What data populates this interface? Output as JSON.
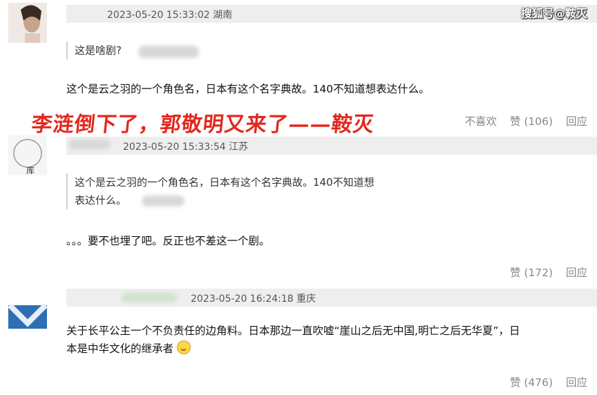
{
  "watermark": "搜狐号@鞍灭",
  "banner": "李涟倒下了，郭敬明又来了——鞍灭",
  "comments": [
    {
      "timestamp": "2023-05-20 15:33:02",
      "location": "湖南",
      "quote": "这是啥剧?",
      "reply": "这个是云之羽的一个角色名，日本有这个名字典故。140不知道想表达什么。",
      "dislike_label": "不喜欢",
      "like_label": "赞 (106)",
      "reply_label": "回应"
    },
    {
      "timestamp": "2023-05-20 15:33:54",
      "location": "江苏",
      "quote_line1": "这个是云之羽的一个角色名，日本有这个名字典故。140不知道想",
      "quote_line2": "表达什么。",
      "reply": "。。。要不也埋了吧。反正也不差这一个剧。",
      "like_label": "赞 (172)",
      "reply_label": "回应"
    },
    {
      "timestamp": "2023-05-20 16:24:18",
      "location": "重庆",
      "reply_line1": "关于长平公主一个不负责任的边角料。日本那边一直吹嘘“崖山之后无中国,明亡之后无华夏”，日",
      "reply_line2": "本是中华文化的继承者",
      "like_label": "赞 (476)",
      "reply_label": "回应"
    }
  ],
  "avatar2_text": "库"
}
